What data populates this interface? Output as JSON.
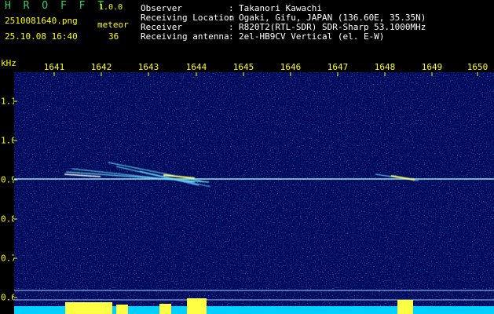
{
  "header": {
    "app_title": "H R O F F T",
    "version": "1.0.0",
    "filename": "2510081640.png",
    "datetime": "25.10.08 16:40",
    "meteor_label": "meteor",
    "meteor_count": "36",
    "info": [
      {
        "label": "Observer",
        "value": "Takanori Kawachi"
      },
      {
        "label": "Receiving Location",
        "value": "Ogaki, Gifu, JAPAN (136.60E, 35.35N)"
      },
      {
        "label": "Receiver",
        "value": "R820T2(RTL-SDR) SDR-Sharp 53.1000MHz"
      },
      {
        "label": "Receiving antenna",
        "value": "2el-HB9CV Vertical (el. E-W)"
      }
    ]
  },
  "axes": {
    "y_unit": "kHz",
    "x_ticks": [
      "1641",
      "1642",
      "1643",
      "1644",
      "1645",
      "1646",
      "1647",
      "1648",
      "1649",
      "1650"
    ],
    "y_ticks": [
      "1.1",
      "1.0",
      "0.9",
      "0.8",
      "0.7",
      "0.6"
    ]
  },
  "colors": {
    "background": "#000000",
    "text_header": "#ffffff",
    "text_axis": "#ffff00",
    "title": "#33cc66",
    "plot_bg": "#000a5c",
    "carrier": "#a0ffff",
    "meteor_echo": "#ffff66",
    "level_bar": "#00d0ff"
  }
}
